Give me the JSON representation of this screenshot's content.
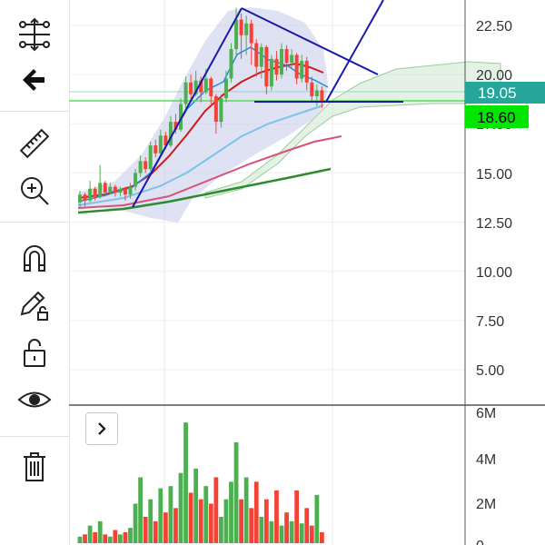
{
  "toolbar": {
    "tools": [
      {
        "name": "indicators-tool",
        "icon": "indicator-sliders-icon"
      },
      {
        "name": "back-tool",
        "icon": "arrow-left-icon"
      },
      {
        "name": "measure-tool",
        "icon": "ruler-icon"
      },
      {
        "name": "zoom-tool",
        "icon": "zoom-in-icon"
      },
      {
        "name": "magnet-tool",
        "icon": "magnet-icon"
      },
      {
        "name": "lock-drawings-tool",
        "icon": "pencil-lock-icon"
      },
      {
        "name": "lock-tool",
        "icon": "unlock-icon"
      },
      {
        "name": "visibility-tool",
        "icon": "eye-icon"
      },
      {
        "name": "delete-tool",
        "icon": "trash-icon"
      }
    ]
  },
  "colors": {
    "up": "#4caf50",
    "down": "#f44336",
    "last_price_badge": "#26a69a",
    "ask_badge": "#00e600",
    "cloud": "#c8e6c9",
    "bollinger": "#c5cae9",
    "trendline": "#1a1aaa"
  },
  "price_axis": {
    "labels": [
      "22.50",
      "20.00",
      "17.50",
      "15.00",
      "12.50",
      "10.00",
      "7.50",
      "5.00"
    ],
    "badge_last": "19.05",
    "badge_ask": "18.60"
  },
  "volume_axis": {
    "labels": [
      "6M",
      "4M",
      "2M",
      "0"
    ]
  },
  "chart_data": {
    "type": "candlestick",
    "price_ticks": [
      22.5,
      20.0,
      17.5,
      15.0,
      12.5,
      10.0,
      7.5,
      5.0
    ],
    "price_range": [
      3.0,
      23.6
    ],
    "last_price": 19.05,
    "ask_price": 18.6,
    "candles": [
      {
        "o": 13.5,
        "c": 13.9,
        "h": 14.1,
        "l": 13.2
      },
      {
        "o": 13.9,
        "c": 13.6,
        "h": 14.0,
        "l": 13.3
      },
      {
        "o": 13.6,
        "c": 14.2,
        "h": 14.6,
        "l": 13.5
      },
      {
        "o": 14.2,
        "c": 13.8,
        "h": 14.3,
        "l": 13.6
      },
      {
        "o": 13.8,
        "c": 14.5,
        "h": 15.4,
        "l": 13.7
      },
      {
        "o": 14.5,
        "c": 14.0,
        "h": 14.6,
        "l": 13.8
      },
      {
        "o": 14.0,
        "c": 14.3,
        "h": 14.5,
        "l": 13.9
      },
      {
        "o": 14.3,
        "c": 14.0,
        "h": 14.4,
        "l": 13.8
      },
      {
        "o": 14.0,
        "c": 14.2,
        "h": 14.3,
        "l": 13.8
      },
      {
        "o": 14.2,
        "c": 13.9,
        "h": 14.3,
        "l": 13.6
      },
      {
        "o": 13.9,
        "c": 14.3,
        "h": 14.5,
        "l": 13.7
      },
      {
        "o": 14.3,
        "c": 15.0,
        "h": 15.2,
        "l": 14.1
      },
      {
        "o": 15.0,
        "c": 15.6,
        "h": 15.9,
        "l": 14.8
      },
      {
        "o": 15.6,
        "c": 15.2,
        "h": 15.8,
        "l": 15.0
      },
      {
        "o": 15.2,
        "c": 16.4,
        "h": 16.6,
        "l": 15.1
      },
      {
        "o": 16.4,
        "c": 16.0,
        "h": 16.7,
        "l": 15.8
      },
      {
        "o": 16.0,
        "c": 16.9,
        "h": 17.2,
        "l": 15.9
      },
      {
        "o": 16.9,
        "c": 16.4,
        "h": 17.1,
        "l": 16.2
      },
      {
        "o": 16.4,
        "c": 17.6,
        "h": 17.9,
        "l": 16.3
      },
      {
        "o": 17.6,
        "c": 17.2,
        "h": 18.0,
        "l": 17.0
      },
      {
        "o": 17.2,
        "c": 18.5,
        "h": 18.8,
        "l": 17.1
      },
      {
        "o": 18.5,
        "c": 19.6,
        "h": 19.9,
        "l": 18.3
      },
      {
        "o": 19.6,
        "c": 19.0,
        "h": 20.0,
        "l": 18.7
      },
      {
        "o": 19.0,
        "c": 19.7,
        "h": 20.2,
        "l": 18.9
      },
      {
        "o": 19.7,
        "c": 19.1,
        "h": 19.9,
        "l": 18.6
      },
      {
        "o": 19.1,
        "c": 19.8,
        "h": 20.3,
        "l": 19.0
      },
      {
        "o": 19.8,
        "c": 18.9,
        "h": 19.9,
        "l": 18.4
      },
      {
        "o": 18.9,
        "c": 17.6,
        "h": 19.0,
        "l": 17.0
      },
      {
        "o": 17.6,
        "c": 18.8,
        "h": 19.0,
        "l": 17.3
      },
      {
        "o": 18.8,
        "c": 19.8,
        "h": 20.2,
        "l": 18.6
      },
      {
        "o": 19.8,
        "c": 21.3,
        "h": 21.6,
        "l": 19.6
      },
      {
        "o": 21.3,
        "c": 22.8,
        "h": 23.4,
        "l": 21.0
      },
      {
        "o": 22.8,
        "c": 22.0,
        "h": 23.1,
        "l": 20.8
      },
      {
        "o": 22.0,
        "c": 22.6,
        "h": 23.0,
        "l": 21.0
      },
      {
        "o": 22.6,
        "c": 21.6,
        "h": 22.8,
        "l": 20.5
      },
      {
        "o": 21.6,
        "c": 20.4,
        "h": 21.8,
        "l": 19.9
      },
      {
        "o": 20.4,
        "c": 21.4,
        "h": 21.6,
        "l": 19.8
      },
      {
        "o": 21.4,
        "c": 19.4,
        "h": 21.5,
        "l": 19.0
      },
      {
        "o": 19.4,
        "c": 20.8,
        "h": 21.0,
        "l": 19.2
      },
      {
        "o": 20.8,
        "c": 20.0,
        "h": 21.2,
        "l": 19.7
      },
      {
        "o": 20.0,
        "c": 21.3,
        "h": 21.6,
        "l": 19.8
      },
      {
        "o": 21.3,
        "c": 20.6,
        "h": 21.5,
        "l": 20.2
      },
      {
        "o": 20.6,
        "c": 21.0,
        "h": 21.3,
        "l": 20.3
      },
      {
        "o": 21.0,
        "c": 19.8,
        "h": 21.1,
        "l": 19.5
      },
      {
        "o": 19.8,
        "c": 20.7,
        "h": 21.0,
        "l": 19.6
      },
      {
        "o": 20.7,
        "c": 19.6,
        "h": 20.9,
        "l": 19.2
      },
      {
        "o": 19.6,
        "c": 18.9,
        "h": 19.9,
        "l": 18.6
      },
      {
        "o": 18.9,
        "c": 19.2,
        "h": 19.5,
        "l": 18.4
      },
      {
        "o": 19.2,
        "c": 18.6,
        "h": 19.4,
        "l": 18.3
      }
    ],
    "volume_ticks": [
      6,
      4,
      2,
      0
    ],
    "volume_unit": "M",
    "volumes": [
      0.3,
      0.4,
      0.8,
      0.5,
      1.0,
      0.4,
      0.3,
      0.6,
      0.4,
      0.5,
      0.7,
      1.8,
      3.0,
      1.2,
      2.0,
      1.0,
      2.5,
      1.4,
      2.6,
      1.6,
      3.2,
      5.5,
      2.3,
      3.4,
      2.0,
      2.6,
      1.8,
      3.0,
      1.2,
      2.0,
      2.8,
      4.6,
      2.0,
      3.0,
      1.6,
      2.8,
      1.2,
      2.0,
      1.0,
      2.4,
      0.8,
      1.4,
      1.0,
      2.4,
      0.9,
      1.6,
      0.8,
      2.2,
      0.5
    ]
  }
}
